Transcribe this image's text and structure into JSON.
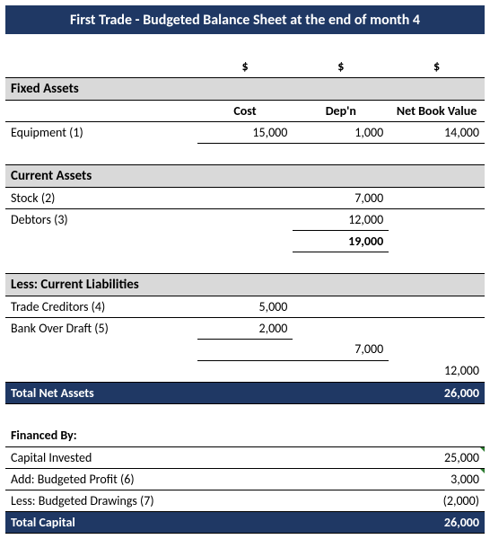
{
  "title": "First Trade - Budgeted Balance Sheet at the end of month 4",
  "currency": "$",
  "sections": {
    "fixed_assets": {
      "heading": "Fixed Assets",
      "cols": {
        "c1": "Cost",
        "c2": "Dep'n",
        "c3": "Net Book Value"
      },
      "rows": {
        "equipment": {
          "label": "Equipment (1)",
          "cost": "15,000",
          "depn": "1,000",
          "nbv": "14,000"
        }
      }
    },
    "current_assets": {
      "heading": "Current Assets",
      "rows": {
        "stock": {
          "label": "Stock (2)",
          "val": "7,000"
        },
        "debtors": {
          "label": "Debtors (3)",
          "val": "12,000"
        }
      },
      "subtotal": "19,000"
    },
    "current_liabilities": {
      "heading": "Less: Current Liabilities",
      "rows": {
        "trade_creditors": {
          "label": "Trade Creditors (4)",
          "val": "5,000"
        },
        "overdraft": {
          "label": "Bank Over Draft (5)",
          "val": "2,000"
        }
      },
      "subtotal": "7,000",
      "net_current": "12,000"
    },
    "total_net_assets": {
      "label": "Total Net Assets",
      "val": "26,000"
    },
    "financed_by": {
      "heading": "Financed By:",
      "rows": {
        "capital_invested": {
          "label": "Capital Invested",
          "val": "25,000"
        },
        "budgeted_profit": {
          "label": "Add: Budgeted Profit (6)",
          "val": "3,000"
        },
        "budgeted_drawings": {
          "label": "Less: Budgeted Drawings (7)",
          "val": "(2,000)"
        }
      }
    },
    "total_capital": {
      "label": "Total Capital",
      "val": "26,000"
    }
  }
}
